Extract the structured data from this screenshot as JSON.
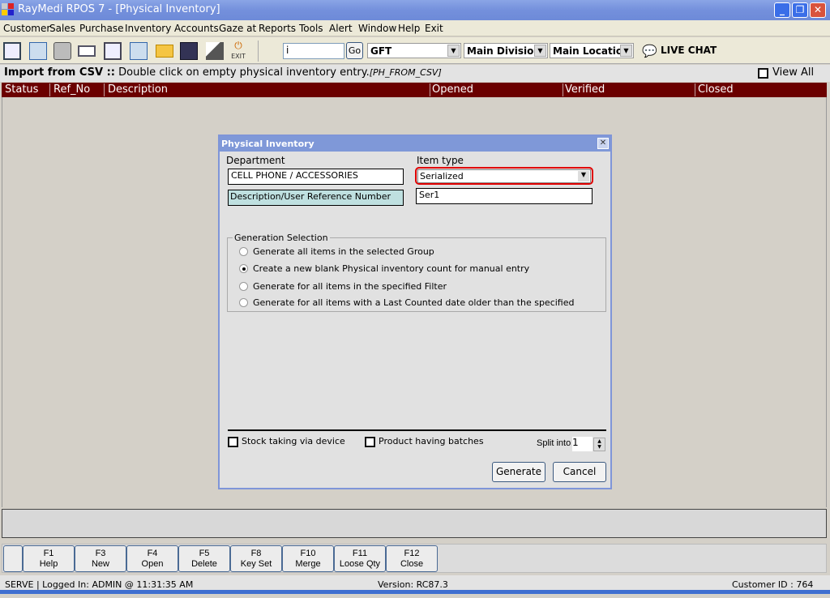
{
  "window": {
    "title": "RayMedi RPOS 7 - [Physical Inventory]",
    "minimize": "_",
    "restore": "❐",
    "close": "✕"
  },
  "menu": [
    "Customer",
    "Sales",
    "Purchase",
    "Inventory",
    "Accounts",
    "Gaze at",
    "Reports",
    "Tools",
    "Alert",
    "Window",
    "Help",
    "Exit"
  ],
  "toolbar": {
    "search_value": "i",
    "go_label": "Go",
    "group_select": "GFT",
    "division_select": "Main Division",
    "location_select": "Main Location",
    "live_chat": "LIVE CHAT",
    "exit_label": "EXIT"
  },
  "info": {
    "bold": "Import from CSV ::",
    "text": " Double click on empty physical inventory entry.",
    "code": "[PH_FROM_CSV]",
    "view_all": "View All"
  },
  "columns": [
    "Status",
    "Ref_No",
    "Description",
    "Opened",
    "Verified",
    "Closed"
  ],
  "dialog": {
    "title": "Physical Inventory",
    "close": "✕",
    "department_label": "Department",
    "department_value": "CELL PHONE / ACCESSORIES",
    "item_type_label": "Item type",
    "item_type_value": "Serialized",
    "desc_label": "Description/User Reference Number",
    "desc_value": "Ser1",
    "group_label": "Generation Selection",
    "options": [
      {
        "label": "Generate all items in the selected Group",
        "selected": false
      },
      {
        "label": "Create a new blank Physical inventory count for manual entry",
        "selected": true
      },
      {
        "label": "Generate for all items in the specified Filter",
        "selected": false
      },
      {
        "label": "Generate for all items with a Last Counted date older than the specified",
        "selected": false
      }
    ],
    "stock_device": "Stock taking via device",
    "batches": "Product having batches",
    "split_label": "Split into",
    "split_value": "1",
    "generate": "Generate",
    "cancel": "Cancel",
    "highlight_color": "#e00000"
  },
  "fkeys": [
    {
      "key": "F1",
      "label": "Help"
    },
    {
      "key": "F3",
      "label": "New"
    },
    {
      "key": "F4",
      "label": "Open"
    },
    {
      "key": "F5",
      "label": "Delete"
    },
    {
      "key": "F8",
      "label": "Key Set"
    },
    {
      "key": "F10",
      "label": "Merge"
    },
    {
      "key": "F11",
      "label": "Loose Qty"
    },
    {
      "key": "F12",
      "label": "Close"
    }
  ],
  "status": {
    "left": "SERVE |  Logged In: ADMIN  @ 11:31:35 AM",
    "version": "Version: RC87.3",
    "customer": "Customer ID : 764"
  }
}
